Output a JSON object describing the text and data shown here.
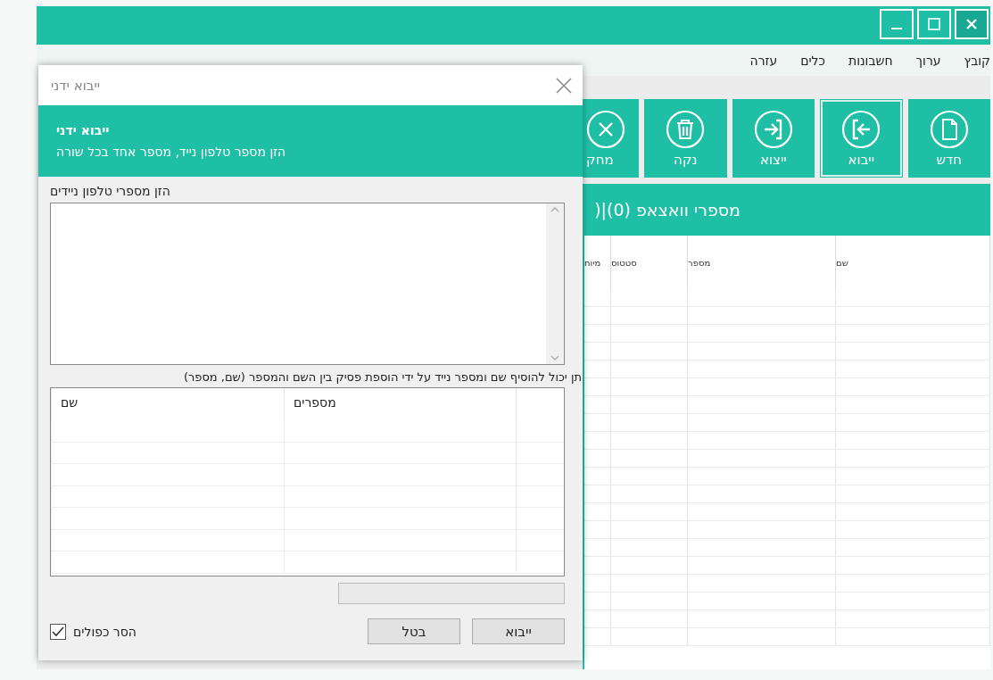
{
  "menu": [
    "קובץ",
    "ערוך",
    "חשבונות",
    "כלים",
    "עזרה"
  ],
  "toolbar": [
    {
      "label": "חדש",
      "kind": "new",
      "selected": false
    },
    {
      "label": "ייבוא",
      "kind": "import",
      "selected": true
    },
    {
      "label": "ייצוא",
      "kind": "export",
      "selected": false
    },
    {
      "label": "נקה",
      "kind": "clear",
      "selected": false
    },
    {
      "label": "מחק",
      "kind": "delete",
      "selected": false
    }
  ],
  "section_title": "מספרי וואצאפ (0)|(",
  "table": {
    "columns": [
      "שם",
      "מספר",
      "סטטוס",
      "מיוח"
    ]
  },
  "dialog": {
    "title": "ייבוא ידני",
    "banner_title": "ייבוא ידני",
    "banner_text": "הזן מספר טלפון נייד, מספר אחד בכל שורה",
    "input_label": "הזן מספרי טלפון ניידים",
    "hint": "תן יכול להוסיף שם ומספר נייד על ידי הוספת פסיק בין השם והמספר (שם, מספר)",
    "grid_columns": [
      "מספרים",
      "שם"
    ],
    "progress": {
      "level": 0
    },
    "remove_duplicates": {
      "label": "הסר כפולים",
      "checked": true
    },
    "buttons": [
      "ייבוא",
      "בטל"
    ]
  }
}
